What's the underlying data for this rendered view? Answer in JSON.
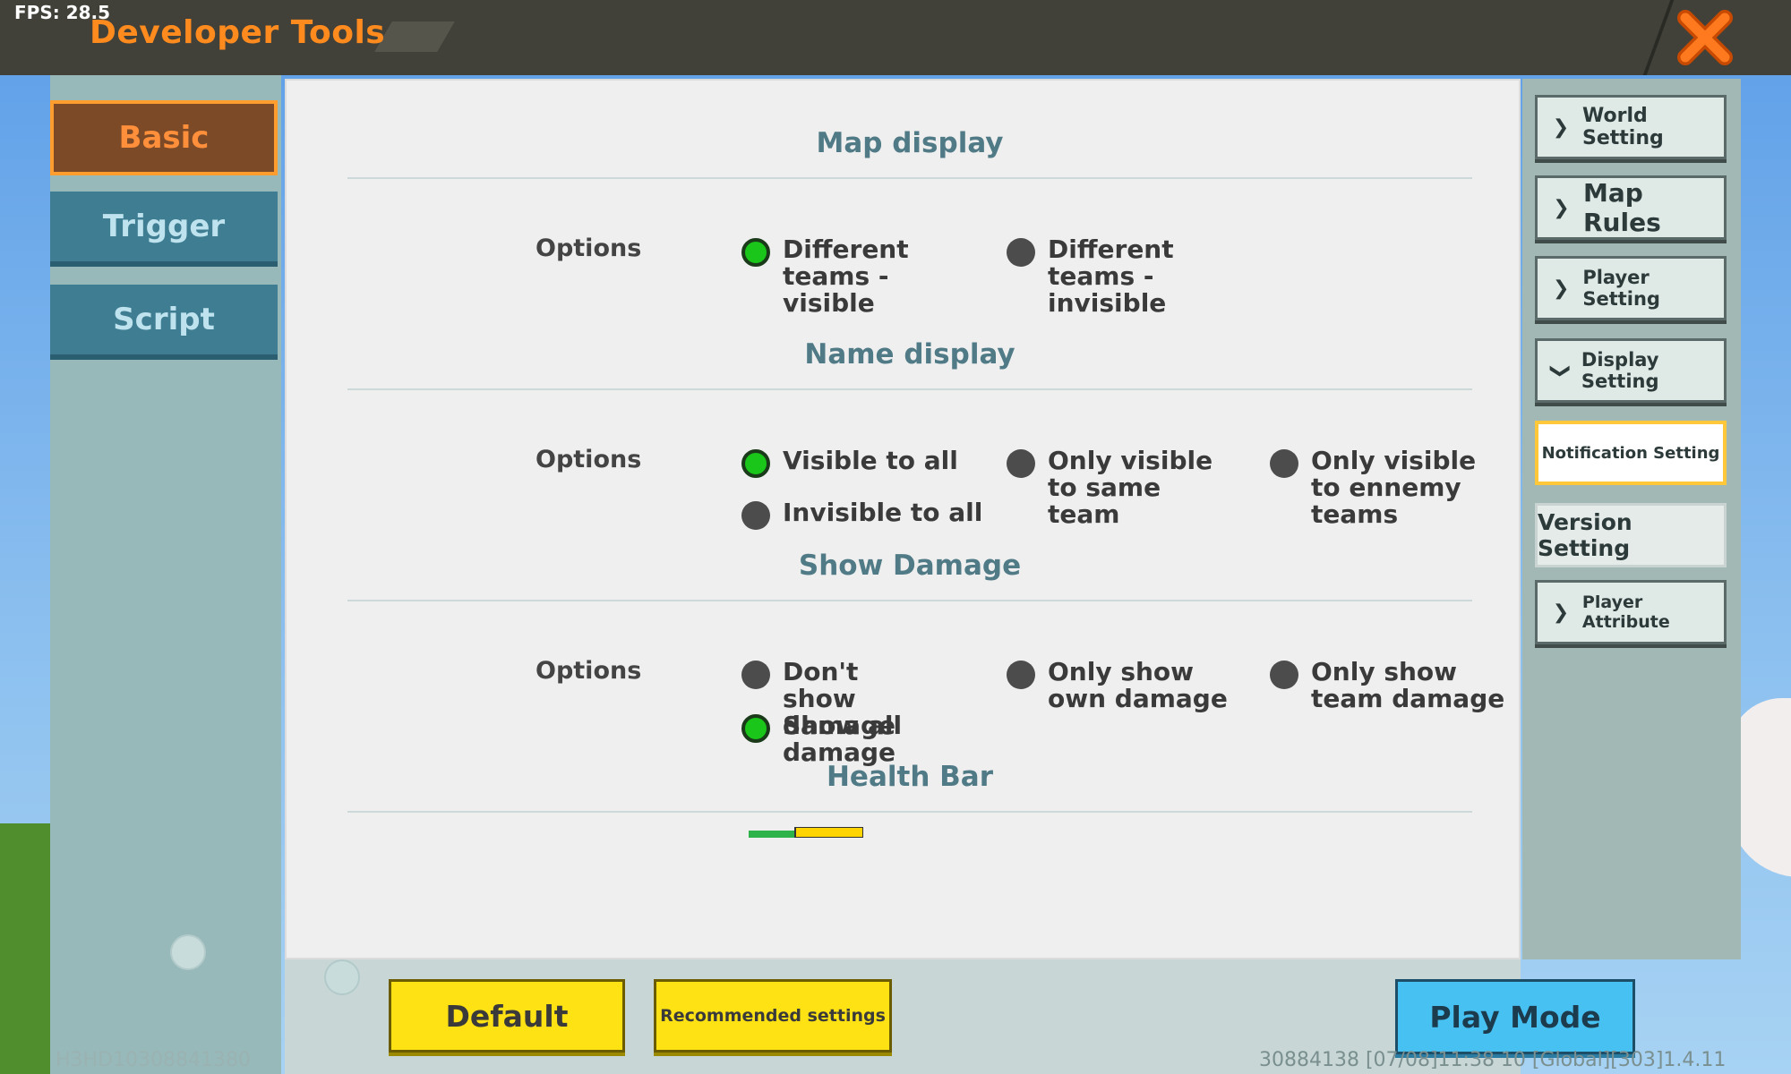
{
  "hud": {
    "fps": "FPS: 28.5"
  },
  "header": {
    "title": "Developer Tools",
    "close_icon": "close-x-icon"
  },
  "left_tabs": [
    {
      "label": "Basic",
      "active": true
    },
    {
      "label": "Trigger",
      "active": false
    },
    {
      "label": "Script",
      "active": false
    }
  ],
  "sections": {
    "map_display": {
      "title": "Map display",
      "options_label": "Options",
      "choices": [
        {
          "label": "Different teams - visible",
          "selected": true
        },
        {
          "label": "Different teams - invisible",
          "selected": false
        }
      ]
    },
    "name_display": {
      "title": "Name display",
      "options_label": "Options",
      "choices": [
        {
          "label": "Visible to all",
          "selected": true
        },
        {
          "label": "Only visible to same team",
          "selected": false
        },
        {
          "label": "Only visible to ennemy teams",
          "selected": false
        },
        {
          "label": "Invisible to all",
          "selected": false
        }
      ]
    },
    "show_damage": {
      "title": "Show Damage",
      "options_label": "Options",
      "choices": [
        {
          "label": "Don't show damage",
          "selected": false
        },
        {
          "label": "Only show own damage",
          "selected": false
        },
        {
          "label": "Only show team damage",
          "selected": false
        },
        {
          "label": "Show all damage",
          "selected": true
        }
      ]
    },
    "health_bar": {
      "title": "Health Bar"
    }
  },
  "buttons": {
    "default": "Default",
    "recommended": "Recommended settings",
    "play_mode": "Play Mode"
  },
  "right_menu": [
    {
      "label": "World Setting",
      "icon": "chevron-right-icon",
      "state": "normal"
    },
    {
      "label": "Map Rules",
      "icon": "chevron-right-icon",
      "state": "normal"
    },
    {
      "label": "Player Setting",
      "icon": "chevron-right-icon",
      "state": "normal"
    },
    {
      "label": "Display Setting",
      "icon": "chevron-down-icon",
      "state": "expanded"
    },
    {
      "label": "Notification Setting",
      "icon": "",
      "state": "active"
    },
    {
      "label": "Version Setting",
      "icon": "",
      "state": "plain"
    },
    {
      "label": "Player Attribute",
      "icon": "chevron-right-icon",
      "state": "normal"
    }
  ],
  "footer": {
    "device_id": "H3HD10308841380",
    "version_info": "30884138    [07/08]11:38 10  [Global][303]1.4.11"
  },
  "colors": {
    "accent_orange": "#ff8a1e",
    "radio_on": "#19c619",
    "radio_off": "#4c4c4c",
    "section_title": "#4f7a86",
    "button_yellow": "#ffe214",
    "button_blue": "#47c1f1"
  }
}
